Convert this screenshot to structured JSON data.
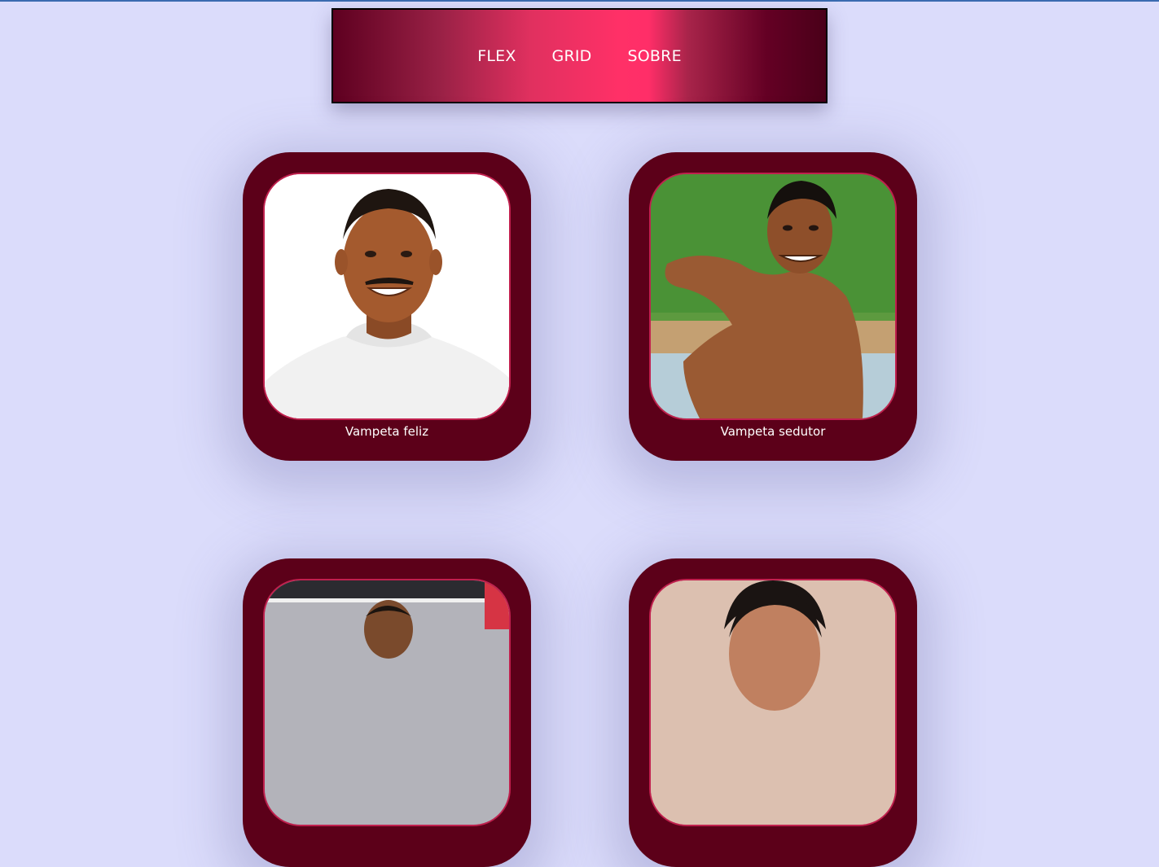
{
  "nav": {
    "links": [
      {
        "label": "FLEX"
      },
      {
        "label": "GRID"
      },
      {
        "label": "SOBRE"
      }
    ]
  },
  "cards": [
    {
      "caption": "Vampeta feliz"
    },
    {
      "caption": "Vampeta sedutor"
    },
    {
      "caption": ""
    },
    {
      "caption": ""
    }
  ],
  "colors": {
    "page_background": "#dbdcfb",
    "card_background": "#5c0019",
    "frame_border": "#c0204e",
    "nav_gradient_center": "#ff3067"
  }
}
